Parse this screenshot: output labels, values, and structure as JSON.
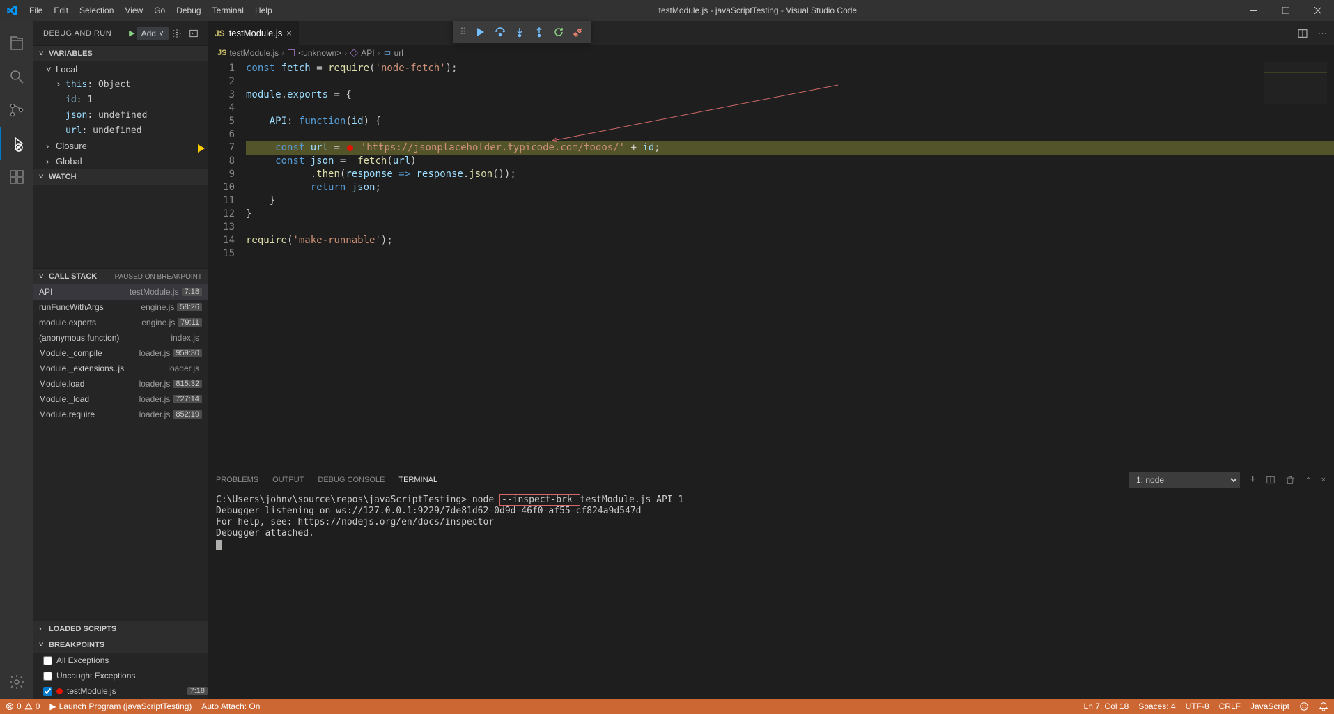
{
  "window_title": "testModule.js - javaScriptTesting - Visual Studio Code",
  "menubar": [
    "File",
    "Edit",
    "Selection",
    "View",
    "Go",
    "Debug",
    "Terminal",
    "Help"
  ],
  "activity": {
    "items": [
      "files",
      "search",
      "scm",
      "debug",
      "extensions"
    ],
    "active": "debug"
  },
  "debug_sidebar": {
    "header": "DEBUG AND RUN",
    "config_label": "Add",
    "sections": {
      "variables": {
        "title": "VARIABLES",
        "scopes": {
          "local": {
            "label": "Local",
            "entries": [
              {
                "k": "this",
                "v": "Object",
                "expandable": true
              },
              {
                "k": "id",
                "v": "1"
              },
              {
                "k": "json",
                "v": "undefined"
              },
              {
                "k": "url",
                "v": "undefined"
              }
            ]
          },
          "closure": {
            "label": "Closure"
          },
          "global": {
            "label": "Global"
          }
        }
      },
      "watch": {
        "title": "WATCH"
      },
      "callstack": {
        "title": "CALL STACK",
        "status": "PAUSED ON BREAKPOINT",
        "frames": [
          {
            "fn": "API",
            "file": "testModule.js",
            "pos": "7:18"
          },
          {
            "fn": "runFuncWithArgs",
            "file": "engine.js",
            "pos": "58:26"
          },
          {
            "fn": "module.exports",
            "file": "engine.js",
            "pos": "79:11"
          },
          {
            "fn": "(anonymous function)",
            "file": "index.js",
            "pos": ""
          },
          {
            "fn": "Module._compile",
            "file": "loader.js",
            "pos": "959:30"
          },
          {
            "fn": "Module._extensions..js",
            "file": "loader.js",
            "pos": ""
          },
          {
            "fn": "Module.load",
            "file": "loader.js",
            "pos": "815:32"
          },
          {
            "fn": "Module._load",
            "file": "loader.js",
            "pos": "727:14"
          },
          {
            "fn": "Module.require",
            "file": "loader.js",
            "pos": "852:19"
          }
        ]
      },
      "loaded_scripts": {
        "title": "LOADED SCRIPTS"
      },
      "breakpoints": {
        "title": "BREAKPOINTS",
        "items": [
          {
            "type": "check",
            "checked": false,
            "label": "All Exceptions"
          },
          {
            "type": "check",
            "checked": false,
            "label": "Uncaught Exceptions"
          },
          {
            "type": "bp",
            "checked": true,
            "label": "testModule.js",
            "pos": "7:18"
          }
        ]
      }
    }
  },
  "editor": {
    "tab": {
      "label": "testModule.js"
    },
    "breadcrumb": [
      {
        "icon": "js",
        "label": "testModule.js"
      },
      {
        "icon": "module",
        "label": "<unknown>"
      },
      {
        "icon": "method",
        "label": "API"
      },
      {
        "icon": "field",
        "label": "url"
      }
    ],
    "active_line": 7,
    "code": [
      {
        "n": 1,
        "html": "<span class='tok-kw'>const</span> <span class='tok-var'>fetch</span> <span class='tok-op'>=</span> <span class='tok-fn'>require</span>(<span class='tok-str'>'node-fetch'</span>);"
      },
      {
        "n": 2,
        "html": ""
      },
      {
        "n": 3,
        "html": "<span class='tok-var'>module</span>.<span class='tok-var'>exports</span> <span class='tok-op'>=</span> {"
      },
      {
        "n": 4,
        "html": ""
      },
      {
        "n": 5,
        "html": "    <span class='tok-var'>API</span>: <span class='tok-kw'>function</span>(<span class='tok-var'>id</span>) {"
      },
      {
        "n": 6,
        "html": ""
      },
      {
        "n": 7,
        "html": "     <span class='tok-kw'>const</span> <span class='tok-var'>url</span> <span class='tok-op'>=</span> <span class='red-dot-inline'></span> <span class='tok-str'>'https://jsonplaceholder.typicode.com/todos/'</span> <span class='tok-op'>+</span> <span class='tok-var'>id</span>;"
      },
      {
        "n": 8,
        "html": "     <span class='tok-kw'>const</span> <span class='tok-var'>json</span> <span class='tok-op'>=</span>  <span class='tok-fn'>fetch</span>(<span class='tok-var'>url</span>)"
      },
      {
        "n": 9,
        "html": "           .<span class='tok-fn'>then</span>(<span class='tok-var'>response</span> <span class='tok-kw'>=></span> <span class='tok-var'>response</span>.<span class='tok-fn'>json</span>());"
      },
      {
        "n": 10,
        "html": "           <span class='tok-kw'>return</span> <span class='tok-var'>json</span>;"
      },
      {
        "n": 11,
        "html": "    }"
      },
      {
        "n": 12,
        "html": "}"
      },
      {
        "n": 13,
        "html": ""
      },
      {
        "n": 14,
        "html": "<span class='tok-fn'>require</span>(<span class='tok-str'>'make-runnable'</span>);"
      },
      {
        "n": 15,
        "html": ""
      }
    ]
  },
  "debug_toolbar": [
    "continue",
    "step-over",
    "step-into",
    "step-out",
    "restart",
    "stop"
  ],
  "panel": {
    "tabs": [
      "PROBLEMS",
      "OUTPUT",
      "DEBUG CONSOLE",
      "TERMINAL"
    ],
    "active": "TERMINAL",
    "dropdown": "1: node",
    "terminal": {
      "prompt": "C:\\Users\\johnv\\source\\repos\\javaScriptTesting>",
      "cmd_pre": "node ",
      "cmd_highlight": "--inspect-brk ",
      "cmd_post": "testModule.js API 1",
      "lines": [
        "Debugger listening on ws://127.0.0.1:9229/7de81d62-0d9d-46f0-af55-cf824a9d547d",
        "For help, see: https://nodejs.org/en/docs/inspector",
        "Debugger attached."
      ]
    }
  },
  "statusbar": {
    "errors": "0",
    "warnings": "0",
    "launch": "Launch Program (javaScriptTesting)",
    "auto_attach": "Auto Attach: On",
    "position": "Ln 7, Col 18",
    "spaces": "Spaces: 4",
    "encoding": "UTF-8",
    "eol": "CRLF",
    "language": "JavaScript"
  }
}
